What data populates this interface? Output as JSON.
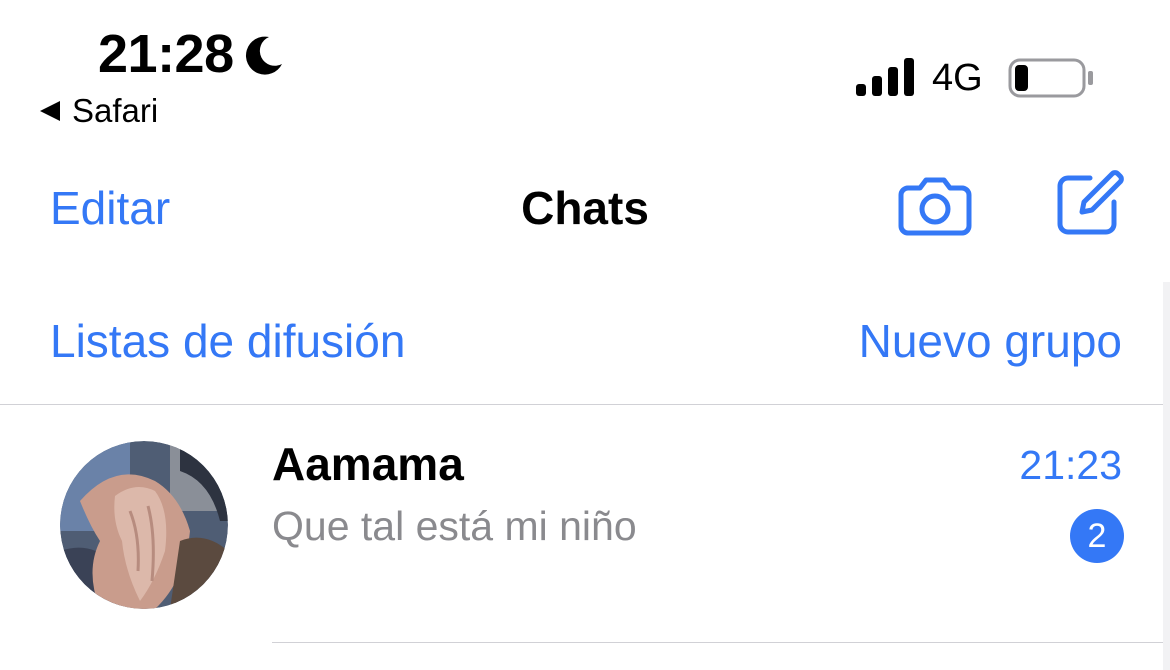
{
  "status_bar": {
    "time": "21:28",
    "back_app": "Safari",
    "network": "4G",
    "icons": [
      "moon-icon",
      "back-arrow-icon",
      "signal-icon",
      "battery-icon"
    ],
    "battery_level": 0.2
  },
  "nav": {
    "edit_label": "Editar",
    "title": "Chats",
    "icons": [
      "camera-icon",
      "compose-icon"
    ]
  },
  "links": {
    "broadcast_label": "Listas de difusión",
    "new_group_label": "Nuevo grupo"
  },
  "chats": [
    {
      "name": "Aamama",
      "preview": "Que tal está mi niño",
      "time": "21:23",
      "unread": "2"
    }
  ],
  "colors": {
    "accent": "#3478f6",
    "secondary_text": "#8a8a8e",
    "separator": "#d1d1d6"
  }
}
